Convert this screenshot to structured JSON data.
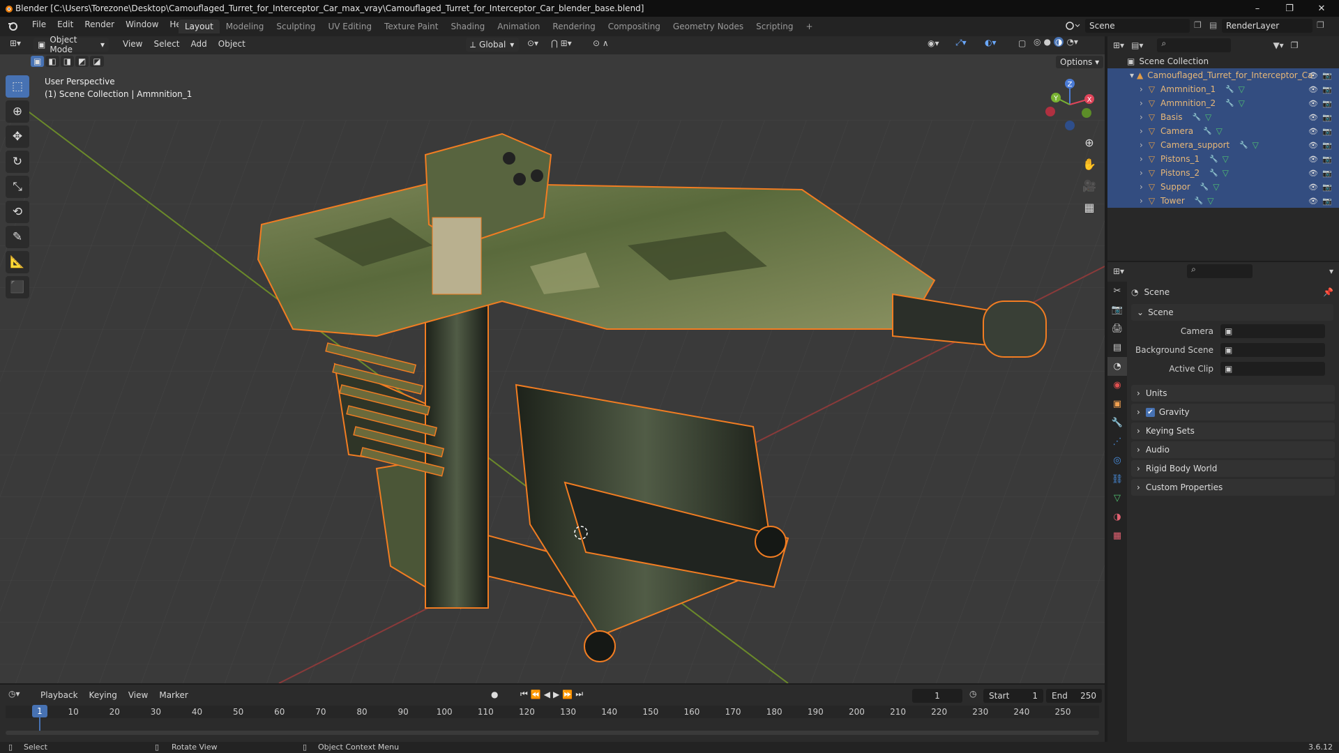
{
  "window": {
    "title": "Blender [C:\\Users\\Torezone\\Desktop\\Camouflaged_Turret_for_Interceptor_Car_max_vray\\Camouflaged_Turret_for_Interceptor_Car_blender_base.blend]",
    "minimize": "–",
    "maximize": "❐",
    "close": "✕"
  },
  "menu": [
    "File",
    "Edit",
    "Render",
    "Window",
    "Help"
  ],
  "workspaces": [
    "Layout",
    "Modeling",
    "Sculpting",
    "UV Editing",
    "Texture Paint",
    "Shading",
    "Animation",
    "Rendering",
    "Compositing",
    "Geometry Nodes",
    "Scripting",
    "+"
  ],
  "active_workspace": "Layout",
  "scene_name": "Scene",
  "view_layer": "RenderLayer",
  "viewport": {
    "mode": "Object Mode",
    "menus": [
      "View",
      "Select",
      "Add",
      "Object"
    ],
    "orientation": "Global",
    "options_label": "Options",
    "perspective": "User Perspective",
    "context": "(1) Scene Collection | Ammnition_1",
    "gizmo": {
      "x": "X",
      "y": "Y",
      "z": "Z"
    }
  },
  "outliner": {
    "root": "Scene Collection",
    "collection": "Camouflaged_Turret_for_Interceptor_Ca",
    "objects": [
      "Ammnition_1",
      "Ammnition_2",
      "Basis",
      "Camera",
      "Camera_support",
      "Pistons_1",
      "Pistons_2",
      "Suppor",
      "Tower"
    ]
  },
  "properties": {
    "header": "Scene",
    "section": "Scene",
    "fields": [
      {
        "label": "Camera",
        "value": ""
      },
      {
        "label": "Background Scene",
        "value": ""
      },
      {
        "label": "Active Clip",
        "value": ""
      }
    ],
    "panels": [
      "Units",
      "Gravity",
      "Keying Sets",
      "Audio",
      "Rigid Body World",
      "Custom Properties"
    ],
    "gravity_checked": true
  },
  "timeline": {
    "menus": [
      "Playback",
      "Keying",
      "View",
      "Marker"
    ],
    "current_frame": "1",
    "start_label": "Start",
    "start": "1",
    "end_label": "End",
    "end": "250",
    "ticks": [
      "1",
      "10",
      "20",
      "30",
      "40",
      "50",
      "60",
      "70",
      "80",
      "90",
      "100",
      "110",
      "120",
      "130",
      "140",
      "150",
      "160",
      "170",
      "180",
      "190",
      "200",
      "210",
      "220",
      "230",
      "240",
      "250"
    ]
  },
  "status": {
    "select": "Select",
    "rotate": "Rotate View",
    "context_menu": "Object Context Menu",
    "version": "3.6.12"
  },
  "colors": {
    "accent": "#4772b3",
    "selection_outline": "#f27d22",
    "camo_dark": "#4d5a32",
    "camo_light": "#8a9262",
    "grid": "#444444"
  }
}
